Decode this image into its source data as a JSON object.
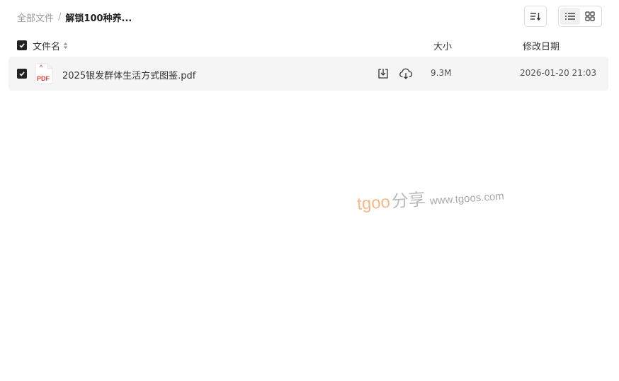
{
  "breadcrumb": {
    "root": "全部文件",
    "separator": "/",
    "current": "解锁100种养..."
  },
  "toolbar": {
    "sort_icon": "sort-lines-icon",
    "views": [
      {
        "name": "list",
        "icon": "list-view-icon",
        "active": true
      },
      {
        "name": "grid",
        "icon": "grid-view-icon",
        "active": false
      }
    ]
  },
  "table": {
    "columns": {
      "name": "文件名",
      "size": "大小",
      "date": "修改日期"
    },
    "select_all_checked": true,
    "rows": [
      {
        "checked": true,
        "icon": "pdf-file-icon",
        "icon_label": "PDF",
        "name": "2025银发群体生活方式图鉴.pdf",
        "size": "9.3M",
        "modified": "2026-01-20 21:03"
      }
    ]
  },
  "watermark": {
    "brand": "tgoo",
    "cn": "分享",
    "url": "www.tgoos.com"
  },
  "colors": {
    "checkbox": "#222222",
    "row_bg": "#f5f5f5",
    "pdf_red": "#e0413b",
    "watermark_brand": "#f7b98a"
  }
}
